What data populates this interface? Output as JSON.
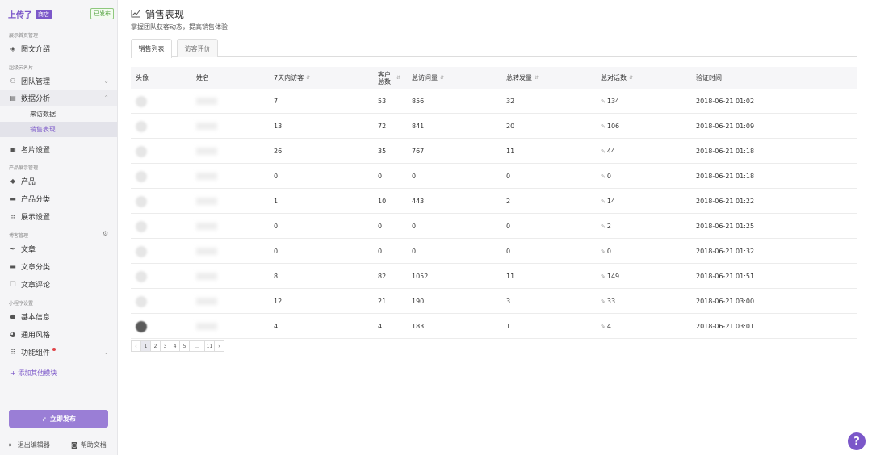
{
  "brand": {
    "name": "上传了",
    "badge": "商店",
    "status": "已发布"
  },
  "sidebar": {
    "sections": [
      "展示首页管理",
      "超级云名片",
      "产品展示管理",
      "博客管理",
      "小程序设置"
    ],
    "items": {
      "intro": "图文介绍",
      "team": "团队管理",
      "analytics": "数据分析",
      "visits": "来访数据",
      "sales": "销售表现",
      "card": "名片设置",
      "product": "产品",
      "category": "产品分类",
      "display": "展示设置",
      "article": "文章",
      "article_cat": "文章分类",
      "comments": "文章评论",
      "basic": "基本信息",
      "style": "通用风格",
      "widgets": "功能组件"
    },
    "add_module": "+ 添加其他模块",
    "publish": "立即发布",
    "exit": "退出编辑器",
    "help": "帮助文档"
  },
  "header": {
    "title": "销售表现",
    "subtitle": "掌握团队获客动态，提高销售体验"
  },
  "tabs": [
    "销售列表",
    "访客评价"
  ],
  "table": {
    "columns": [
      "头像",
      "姓名",
      "7天内访客",
      "客户总数",
      "总访问量",
      "总转发量",
      "总对话数",
      "验证时间"
    ],
    "rows": [
      [
        "7",
        "53",
        "856",
        "32",
        "134",
        "2018-06-21 01:02"
      ],
      [
        "13",
        "72",
        "841",
        "20",
        "106",
        "2018-06-21 01:09"
      ],
      [
        "26",
        "35",
        "767",
        "11",
        "44",
        "2018-06-21 01:18"
      ],
      [
        "0",
        "0",
        "0",
        "0",
        "0",
        "2018-06-21 01:18"
      ],
      [
        "1",
        "10",
        "443",
        "2",
        "14",
        "2018-06-21 01:22"
      ],
      [
        "0",
        "0",
        "0",
        "0",
        "2",
        "2018-06-21 01:25"
      ],
      [
        "0",
        "0",
        "0",
        "0",
        "0",
        "2018-06-21 01:32"
      ],
      [
        "8",
        "82",
        "1052",
        "11",
        "149",
        "2018-06-21 01:51"
      ],
      [
        "12",
        "21",
        "190",
        "3",
        "33",
        "2018-06-21 03:00"
      ],
      [
        "4",
        "4",
        "183",
        "1",
        "4",
        "2018-06-21 03:01"
      ]
    ]
  },
  "pagination": [
    "‹",
    "1",
    "2",
    "3",
    "4",
    "5",
    "…",
    "11",
    "›"
  ],
  "help_fab": "?",
  "colors": {
    "accent": "#7b57c9",
    "publish": "#9a7ed6",
    "published_tag": "#52a23e"
  }
}
